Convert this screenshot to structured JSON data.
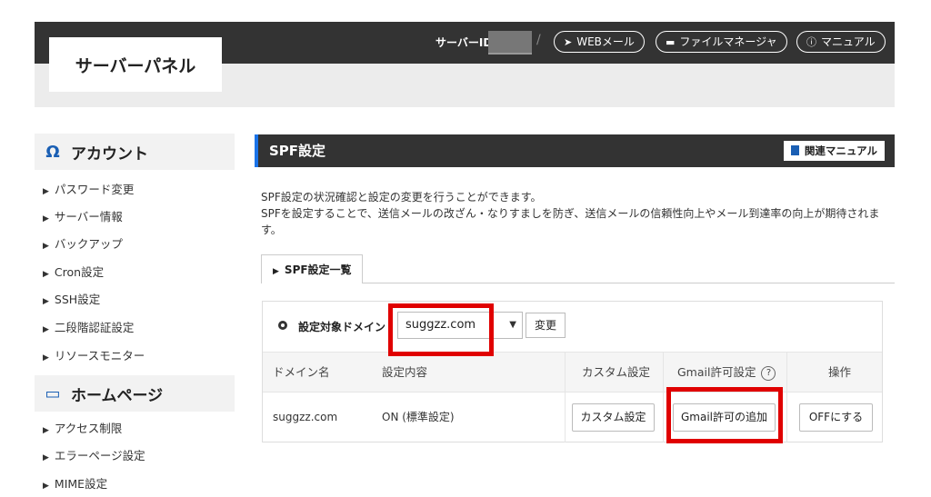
{
  "header": {
    "logo": "サーバーパネル",
    "server_id_label": "サーバーID",
    "separator": "/",
    "buttons": [
      {
        "icon": "send-icon",
        "label": "WEBメール"
      },
      {
        "icon": "folder-icon",
        "label": "ファイルマネージャ"
      },
      {
        "icon": "help-icon",
        "label": "マニュアル"
      }
    ]
  },
  "sidebar": {
    "sections": [
      {
        "title": "アカウント",
        "icon": "user-icon",
        "items": [
          "パスワード変更",
          "サーバー情報",
          "バックアップ",
          "Cron設定",
          "SSH設定",
          "二段階認証設定",
          "リソースモニター"
        ]
      },
      {
        "title": "ホームページ",
        "icon": "monitor-icon",
        "items": [
          "アクセス制限",
          "エラーページ設定",
          "MIME設定"
        ]
      }
    ]
  },
  "main": {
    "title": "SPF設定",
    "manual_button": "関連マニュアル",
    "description_line1": "SPF設定の状況確認と設定の変更を行うことができます。",
    "description_line2": "SPFを設定することで、送信メールの改ざん・なりすましを防ぎ、送信メールの信頼性向上やメール到達率の向上が期待されます。",
    "tab": "SPF設定一覧",
    "target_label": "設定対象ドメイン",
    "selected_domain": "suggzz.com",
    "change_button": "変更",
    "columns": [
      "ドメイン名",
      "設定内容",
      "カスタム設定",
      "Gmail許可設定",
      "操作"
    ],
    "rows": [
      {
        "domain": "suggzz.com",
        "setting": "ON (標準設定)",
        "custom_button": "カスタム設定",
        "gmail_button": "Gmail許可の追加",
        "action_button": "OFFにする"
      }
    ],
    "help_glyph": "?"
  },
  "colors": {
    "header_bg": "#333333",
    "accent_blue": "#1a73e8",
    "highlight_red": "#e00000"
  }
}
